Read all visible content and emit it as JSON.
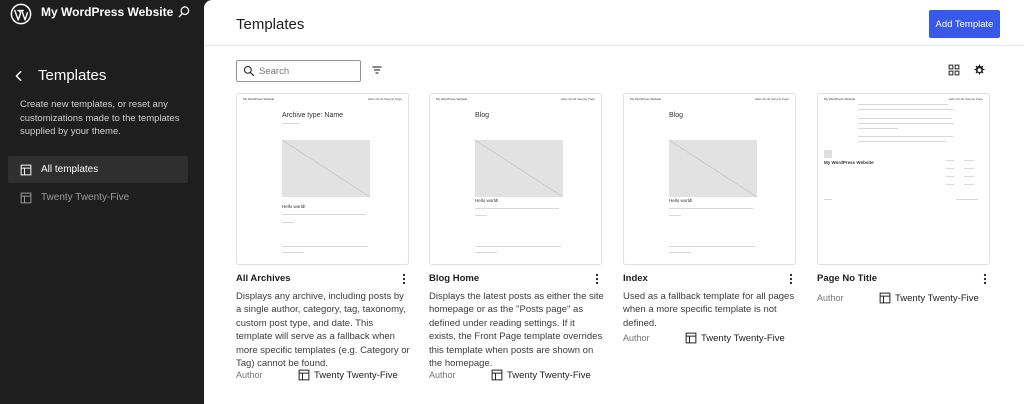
{
  "site": {
    "title": "My WordPress Website"
  },
  "sidebar": {
    "heading": "Templates",
    "description": "Create new templates, or reset any customizations made to the templates supplied by your theme.",
    "items": [
      {
        "label": "All templates",
        "active": true
      },
      {
        "label": "Twenty Twenty-Five",
        "active": false
      }
    ]
  },
  "main": {
    "title": "Templates",
    "add_button": "Add Template",
    "search_placeholder": "Search"
  },
  "cards": [
    {
      "name": "All Archives",
      "description": "Displays any archive, including posts by a single author, category, tag, taxonomy, custom post type, and date. This template will serve as a fallback when more specific templates (e.g. Category or Tag) cannot be found.",
      "author_label": "Author",
      "author": "Twenty Twenty-Five",
      "preview": {
        "site": "My WordPress Website",
        "nav": "Hello World Sample Page",
        "title": "Archive type: Name",
        "hello": "Hello world!"
      }
    },
    {
      "name": "Blog Home",
      "description": "Displays the latest posts as either the site homepage or as the \"Posts page\" as defined under reading settings. If it exists, the Front Page template overrides this template when posts are shown on the homepage.",
      "author_label": "Author",
      "author": "Twenty Twenty-Five",
      "preview": {
        "site": "My WordPress Website",
        "nav": "Hello World Sample Page",
        "title": "Blog",
        "hello": "Hello world!"
      }
    },
    {
      "name": "Index",
      "description": "Used as a fallback template for all pages when a more specific template is not defined.",
      "author_label": "Author",
      "author": "Twenty Twenty-Five",
      "preview": {
        "site": "My WordPress Website",
        "nav": "Hello World Sample Page",
        "title": "Blog",
        "hello": "Hello world!"
      }
    },
    {
      "name": "Page No Title",
      "description": "",
      "author_label": "Author",
      "author": "Twenty Twenty-Five",
      "preview": {
        "site": "My WordPress Website",
        "nav": "Hello World Sample Page",
        "title": "",
        "hello": ""
      }
    }
  ],
  "colors": {
    "accent": "#3858e9",
    "sidebar_bg": "#1e1e1e"
  }
}
